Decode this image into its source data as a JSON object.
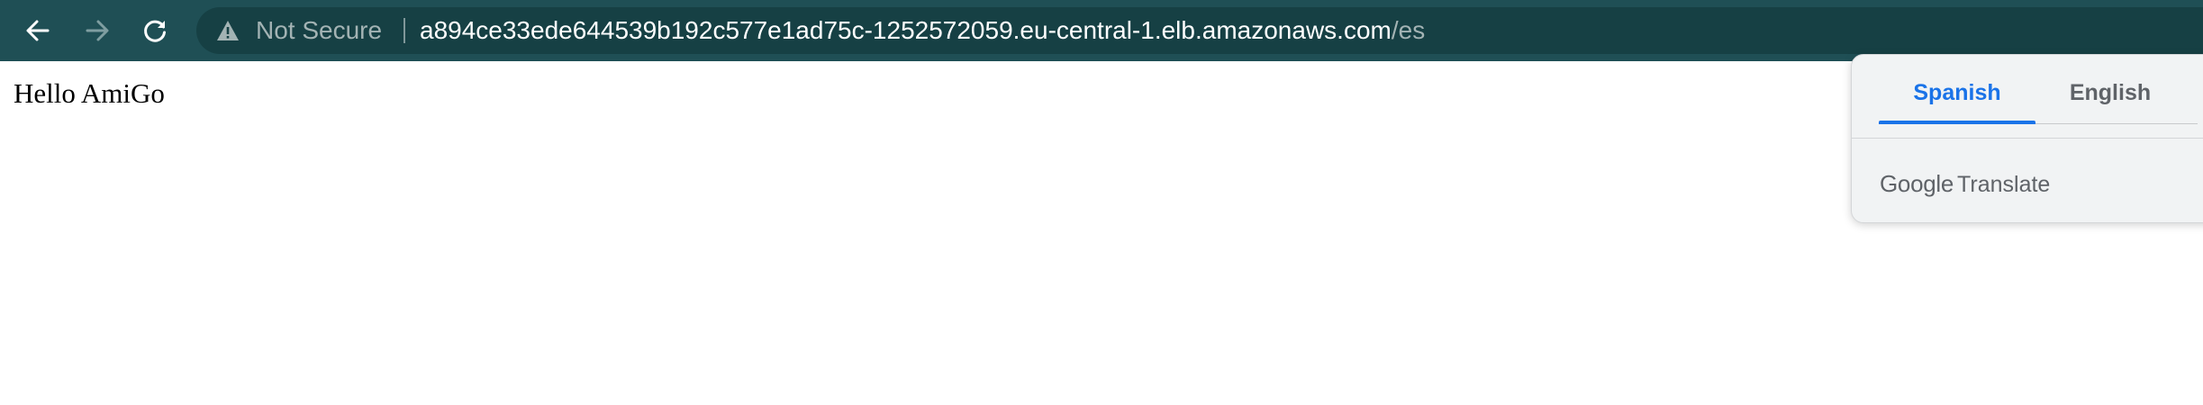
{
  "browser": {
    "nav": {
      "back_icon": "arrow-left-icon",
      "forward_icon": "arrow-right-icon",
      "reload_icon": "reload-icon"
    },
    "omnibox": {
      "security_icon": "warning-triangle-icon",
      "security_label": "Not Secure",
      "url_host": "a894ce33ede644539b192c577e1ad75c-1252572059.eu-central-1.elb.amazonaws.com",
      "url_path": "/es"
    },
    "colors": {
      "toolbar": "#1f4f55",
      "omnibox": "#164044",
      "accent": "#1a73e8"
    }
  },
  "page": {
    "text": "Hello AmiGo"
  },
  "translate_popup": {
    "tabs": [
      {
        "label": "Spanish",
        "selected": true
      },
      {
        "label": "English",
        "selected": false
      }
    ],
    "brand_logo": "Google",
    "brand_product": "Translate"
  }
}
